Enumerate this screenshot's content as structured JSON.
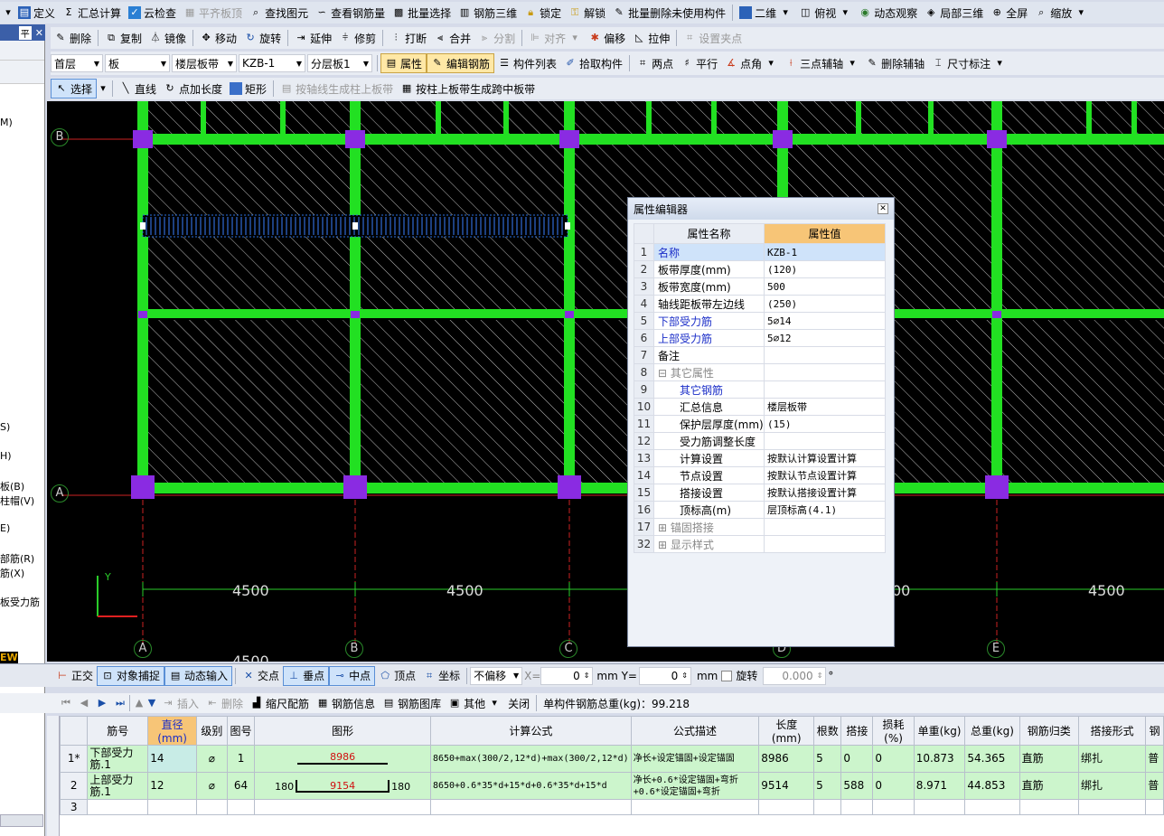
{
  "toolbar1": {
    "items": [
      "定义",
      "汇总计算",
      "云检查",
      "平齐板顶",
      "查找图元",
      "查看钢筋量",
      "批量选择",
      "钢筋三维",
      "锁定",
      "解锁",
      "批量删除未使用构件",
      "二维",
      "俯视",
      "动态观察",
      "局部三维",
      "全屏",
      "缩放"
    ]
  },
  "toolbar2": {
    "items": [
      "删除",
      "复制",
      "镜像",
      "移动",
      "旋转",
      "延伸",
      "修剪",
      "打断",
      "合并",
      "分割",
      "对齐",
      "偏移",
      "拉伸",
      "设置夹点"
    ]
  },
  "toolbar3": {
    "floor": "首层",
    "type": "板",
    "subtype": "楼层板带",
    "component": "KZB-1",
    "layer": "分层板1",
    "attr": "属性",
    "edit_rebar": "编辑钢筋",
    "component_list": "构件列表",
    "pick": "拾取构件",
    "two_points": "两点",
    "parallel": "平行",
    "point_angle": "点角",
    "three_point": "三点辅轴",
    "delete_aux": "删除辅轴",
    "dimension": "尺寸标注"
  },
  "toolbar4": {
    "select": "选择",
    "line": "直线",
    "point_length": "点加长度",
    "rect": "矩形",
    "gen_by_axis": "按轴线生成柱上板带",
    "gen_by_column": "按柱上板带生成跨中板带"
  },
  "left_panel": {
    "title_btn": "平",
    "items": [
      "M)",
      "S)",
      "H)",
      "板(B)",
      "柱帽(V)",
      "E)",
      "部筋(R)",
      "筋(X)",
      "板受力筋",
      "EW"
    ]
  },
  "canvas": {
    "axis_top": [
      "A",
      "B",
      "C",
      "D",
      "E"
    ],
    "axis_side": [
      "B",
      "A"
    ],
    "dims": [
      "4500",
      "4500",
      "00",
      "4500"
    ],
    "dim_below": "4500",
    "ucs_y": "Y"
  },
  "property_editor": {
    "title": "属性编辑器",
    "col_name": "属性名称",
    "col_value": "属性值",
    "rows": [
      {
        "no": "1",
        "name": "名称",
        "value": "KZB-1",
        "style": "blue"
      },
      {
        "no": "2",
        "name": "板带厚度(mm)",
        "value": "(120)",
        "style": ""
      },
      {
        "no": "3",
        "name": "板带宽度(mm)",
        "value": "500",
        "style": ""
      },
      {
        "no": "4",
        "name": "轴线距板带左边线",
        "value": "(250)",
        "style": ""
      },
      {
        "no": "5",
        "name": "下部受力筋",
        "value": "5⌀14",
        "style": "blue"
      },
      {
        "no": "6",
        "name": "上部受力筋",
        "value": "5⌀12",
        "style": "blue"
      },
      {
        "no": "7",
        "name": "备注",
        "value": "",
        "style": ""
      },
      {
        "no": "8",
        "name": "⊟ 其它属性",
        "value": "",
        "style": "gray"
      },
      {
        "no": "9",
        "name": "　　其它钢筋",
        "value": "",
        "style": "blue"
      },
      {
        "no": "10",
        "name": "　　汇总信息",
        "value": "楼层板带",
        "style": ""
      },
      {
        "no": "11",
        "name": "　　保护层厚度(mm)",
        "value": "(15)",
        "style": ""
      },
      {
        "no": "12",
        "name": "　　受力筋调整长度",
        "value": "",
        "style": ""
      },
      {
        "no": "13",
        "name": "　　计算设置",
        "value": "按默认计算设置计算",
        "style": ""
      },
      {
        "no": "14",
        "name": "　　节点设置",
        "value": "按默认节点设置计算",
        "style": ""
      },
      {
        "no": "15",
        "name": "　　搭接设置",
        "value": "按默认搭接设置计算",
        "style": ""
      },
      {
        "no": "16",
        "name": "　　顶标高(m)",
        "value": "层顶标高(4.1)",
        "style": ""
      },
      {
        "no": "17",
        "name": "⊞ 锚固搭接",
        "value": "",
        "style": "gray"
      },
      {
        "no": "32",
        "name": "⊞ 显示样式",
        "value": "",
        "style": "gray"
      }
    ]
  },
  "status_bar": {
    "ortho": "正交",
    "snap": "对象捕捉",
    "dynamic": "动态输入",
    "intersect": "交点",
    "perp": "垂点",
    "mid": "中点",
    "vertex": "顶点",
    "coord": "坐标",
    "offset": "不偏移",
    "x_label": "X=",
    "x_val": "0",
    "y_label": "mm Y=",
    "y_val": "0",
    "mm": "mm",
    "rotate": "旋转",
    "rotate_val": "0.000"
  },
  "rebar_toolbar": {
    "insert": "插入",
    "delete": "删除",
    "scale": "缩尺配筋",
    "info": "钢筋信息",
    "library": "钢筋图库",
    "other": "其他",
    "close": "关闭",
    "total": "单构件钢筋总重(kg)：99.218"
  },
  "rebar_table": {
    "headers": [
      "筋号",
      "直径(mm)",
      "级别",
      "图号",
      "图形",
      "计算公式",
      "公式描述",
      "长度(mm)",
      "根数",
      "搭接",
      "损耗(%)",
      "单重(kg)",
      "总重(kg)",
      "钢筋归类",
      "搭接形式",
      "钢"
    ],
    "rows": [
      {
        "no": "1*",
        "name": "下部受力筋.1",
        "dia": "14",
        "grade": "⌀",
        "fig": "1",
        "shape_left": "",
        "shape_mid": "8986",
        "shape_right": "",
        "formula": "8650+max(300/2,12*d)+max(300/2,12*d)",
        "desc": "净长+设定锚固+设定锚固",
        "len": "8986",
        "count": "5",
        "lap": "0",
        "loss": "0",
        "unit_w": "10.873",
        "total_w": "54.365",
        "class": "直筋",
        "lap_type": "绑扎",
        "extra": "普"
      },
      {
        "no": "2",
        "name": "上部受力筋.1",
        "dia": "12",
        "grade": "⌀",
        "fig": "64",
        "shape_left": "180",
        "shape_mid": "9154",
        "shape_right": "180",
        "formula": "8650+0.6*35*d+15*d+0.6*35*d+15*d",
        "desc": "净长+0.6*设定锚固+弯折+0.6*设定锚固+弯折",
        "len": "9514",
        "count": "5",
        "lap": "588",
        "loss": "0",
        "unit_w": "8.971",
        "total_w": "44.853",
        "class": "直筋",
        "lap_type": "绑扎",
        "extra": "普"
      }
    ],
    "empty_no": "3"
  }
}
